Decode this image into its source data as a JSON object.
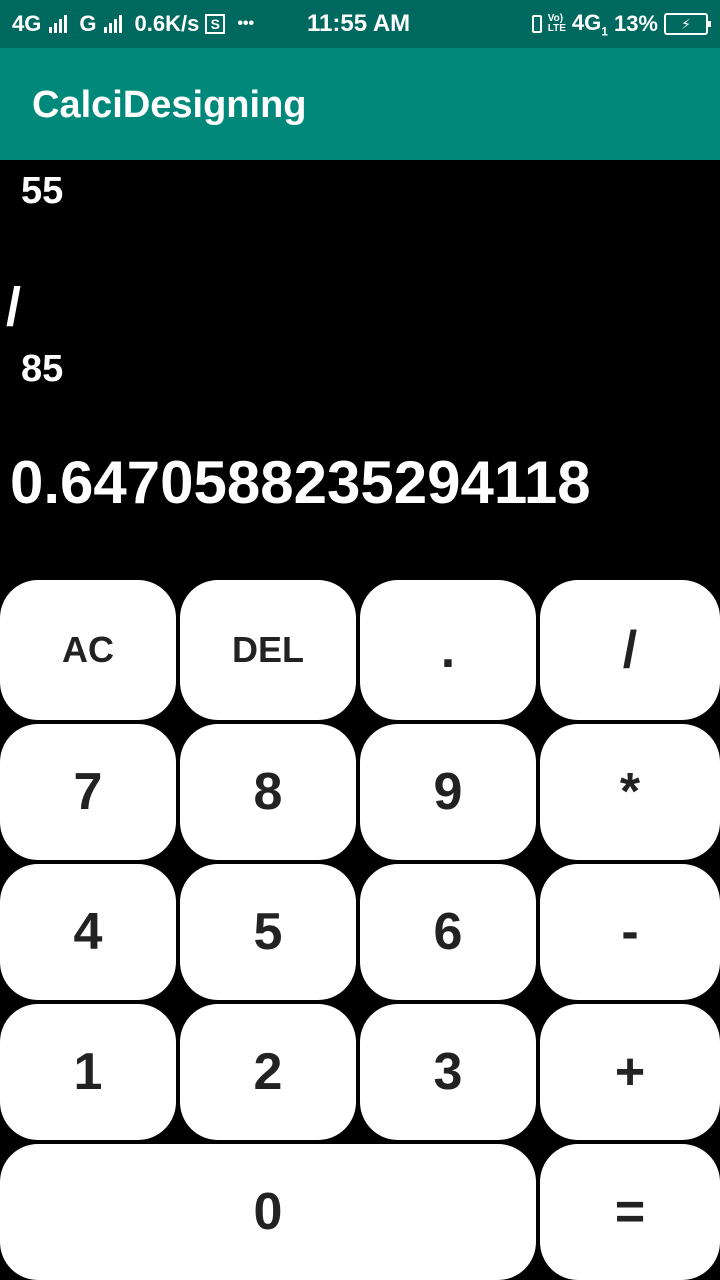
{
  "status_bar": {
    "network1": "4G",
    "network2": "G",
    "speed": "0.6K/s",
    "s_icon": "S",
    "more": "•••",
    "time": "11:55 AM",
    "lte_top": "Vo)",
    "lte_bottom": "LTE",
    "network3": "4G",
    "sim": "1",
    "battery": "13%",
    "battery_symbol": "⚡"
  },
  "app_bar": {
    "title": "CalciDesigning"
  },
  "display": {
    "operand1": "55",
    "operator": "/",
    "operand2": "85",
    "result": "0.6470588235294118"
  },
  "keypad": {
    "ac": "AC",
    "del": "DEL",
    "dot": ".",
    "divide": "/",
    "seven": "7",
    "eight": "8",
    "nine": "9",
    "multiply": "*",
    "four": "4",
    "five": "5",
    "six": "6",
    "minus": "-",
    "one": "1",
    "two": "2",
    "three": "3",
    "plus": "+",
    "zero": "0",
    "equals": "="
  },
  "colors": {
    "status_bar": "#00695F",
    "app_bar": "#00897B",
    "background": "#000000",
    "key": "#FFFFFF",
    "key_text": "#222222"
  }
}
